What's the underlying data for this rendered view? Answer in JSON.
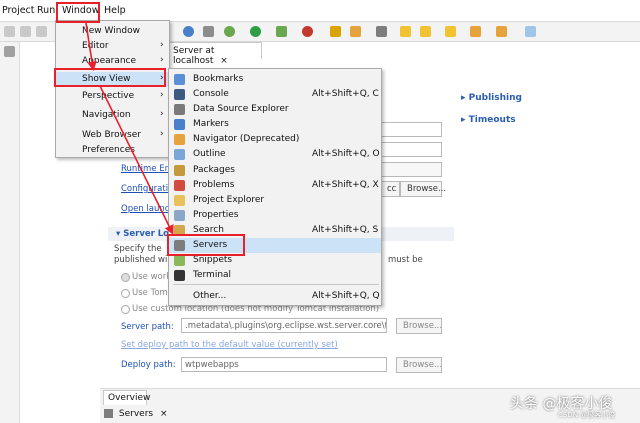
{
  "menubar": {
    "project": "Project",
    "run": "Run",
    "window": "Window",
    "help": "Help"
  },
  "editor": {
    "tab_label": "Server at localhost",
    "tab_close": "×",
    "publishing": "Publishing",
    "timeouts": "Timeouts",
    "runtime_env": "Runtime Env",
    "configuration": "Configurati",
    "open_launch": "Open launc",
    "server_locations": "Server Lo",
    "specify_the": "Specify the",
    "published_wit": "published wi",
    "must_be": "must be",
    "radio_use_work": "Use work",
    "radio_use_tom": "Use Tom",
    "radio_custom": "Use custom location (does not modify Tomcat installation)",
    "server_path_label": "Server path:",
    "server_path_value": ".metadata\\.plugins\\org.eclipse.wst.server.core\\tmp",
    "browse": "Browse...",
    "set_deploy_link": "Set deploy path to the default value (currently set)",
    "deploy_path_label": "Deploy path:",
    "deploy_path_value": "wtpwebapps",
    "browse2": "Browse...",
    "browse3": "Browse...",
    "browse_enabled": "Browse...",
    "acc": "cc",
    "overview_tab": "Overview",
    "servers_tab": "Servers",
    "servers_tab_close": "×"
  },
  "window_menu": {
    "items": [
      {
        "label": "New Window"
      },
      {
        "label": "Editor"
      },
      {
        "label": "Appearance"
      },
      {
        "label": "Show View"
      },
      {
        "label": "Perspective"
      },
      {
        "label": "Navigation"
      },
      {
        "label": "Web Browser"
      },
      {
        "label": "Preferences"
      }
    ]
  },
  "show_view_menu": {
    "items": [
      {
        "label": "Bookmarks",
        "shortcut": "",
        "icon": "bookmark-icon"
      },
      {
        "label": "Console",
        "shortcut": "Alt+Shift+Q, C",
        "icon": "console-icon"
      },
      {
        "label": "Data Source Explorer",
        "shortcut": "",
        "icon": "database-icon"
      },
      {
        "label": "Markers",
        "shortcut": "",
        "icon": "markers-icon"
      },
      {
        "label": "Navigator (Deprecated)",
        "shortcut": "",
        "icon": "navigator-icon"
      },
      {
        "label": "Outline",
        "shortcut": "Alt+Shift+Q, O",
        "icon": "outline-icon"
      },
      {
        "label": "Packages",
        "shortcut": "",
        "icon": "packages-icon"
      },
      {
        "label": "Problems",
        "shortcut": "Alt+Shift+Q, X",
        "icon": "problems-icon"
      },
      {
        "label": "Project Explorer",
        "shortcut": "",
        "icon": "folder-icon"
      },
      {
        "label": "Properties",
        "shortcut": "",
        "icon": "properties-icon"
      },
      {
        "label": "Search",
        "shortcut": "Alt+Shift+Q, S",
        "icon": "search-icon"
      },
      {
        "label": "Servers",
        "shortcut": "",
        "icon": "servers-icon"
      },
      {
        "label": "Snippets",
        "shortcut": "",
        "icon": "snippets-icon"
      },
      {
        "label": "Terminal",
        "shortcut": "",
        "icon": "terminal-icon"
      },
      {
        "label": "Other...",
        "shortcut": "Alt+Shift+Q, Q",
        "icon": ""
      }
    ]
  },
  "watermark": {
    "main": "头条 @极客小俊",
    "sub": "CSDN @极客小俊"
  },
  "colors": {
    "highlight": "#cce3f7",
    "accent_red": "#e8202a",
    "link_blue": "#1f4fb8"
  }
}
